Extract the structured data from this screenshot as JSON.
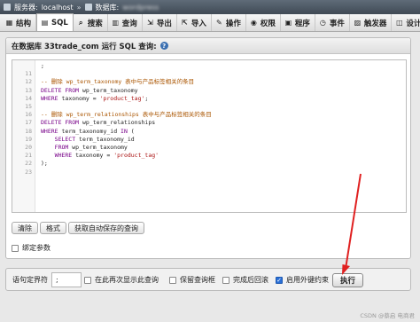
{
  "breadcrumb": {
    "server_label": "服务器:",
    "server_value": "localhost",
    "separator": "»",
    "db_label": "数据库:",
    "db_value": "wordpress"
  },
  "tabs": [
    {
      "label": "结构",
      "icon": "structure-icon",
      "glyph": "▦"
    },
    {
      "label": "SQL",
      "icon": "sql-icon",
      "glyph": "▤"
    },
    {
      "label": "搜索",
      "icon": "search-icon",
      "glyph": "⌕"
    },
    {
      "label": "查询",
      "icon": "query-icon",
      "glyph": "▥"
    },
    {
      "label": "导出",
      "icon": "export-icon",
      "glyph": "⇲"
    },
    {
      "label": "导入",
      "icon": "import-icon",
      "glyph": "⇱"
    },
    {
      "label": "操作",
      "icon": "wrench-icon",
      "glyph": "✎"
    },
    {
      "label": "权限",
      "icon": "privileges-icon",
      "glyph": "◉"
    },
    {
      "label": "程序",
      "icon": "routines-icon",
      "glyph": "▣"
    },
    {
      "label": "事件",
      "icon": "events-icon",
      "glyph": "◷"
    },
    {
      "label": "触发器",
      "icon": "triggers-icon",
      "glyph": "▨"
    },
    {
      "label": "设计器",
      "icon": "designer-icon",
      "glyph": "◫"
    }
  ],
  "panel": {
    "title": "在数据库 33trade_com 运行 SQL 查询:",
    "help_glyph": "?"
  },
  "editor": {
    "lines": [
      {
        "n": "",
        "segments": [
          {
            "t": ";",
            "c": "plain"
          }
        ]
      },
      {
        "n": "11",
        "segments": []
      },
      {
        "n": "12",
        "segments": [
          {
            "t": "-- 删除 wp_term_taxonomy 表中与产品标签相关的条目",
            "c": "cmt"
          }
        ]
      },
      {
        "n": "13",
        "segments": [
          {
            "t": "DELETE FROM",
            "c": "kw"
          },
          {
            "t": " wp_term_taxonomy",
            "c": "plain"
          }
        ]
      },
      {
        "n": "14",
        "segments": [
          {
            "t": "WHERE",
            "c": "kw"
          },
          {
            "t": " taxonomy = ",
            "c": "plain"
          },
          {
            "t": "'product_tag'",
            "c": "str"
          },
          {
            "t": ";",
            "c": "plain"
          }
        ]
      },
      {
        "n": "15",
        "segments": []
      },
      {
        "n": "16",
        "segments": [
          {
            "t": "-- 删除 wp_term_relationships 表中与产品标签相关的条目",
            "c": "cmt"
          }
        ]
      },
      {
        "n": "17",
        "segments": [
          {
            "t": "DELETE FROM",
            "c": "kw"
          },
          {
            "t": " wp_term_relationships",
            "c": "plain"
          }
        ]
      },
      {
        "n": "18",
        "segments": [
          {
            "t": "WHERE",
            "c": "kw"
          },
          {
            "t": " term_taxonomy_id ",
            "c": "plain"
          },
          {
            "t": "IN",
            "c": "kw"
          },
          {
            "t": " (",
            "c": "plain"
          }
        ]
      },
      {
        "n": "19",
        "segments": [
          {
            "t": "    ",
            "c": "plain"
          },
          {
            "t": "SELECT",
            "c": "kw"
          },
          {
            "t": " term_taxonomy_id",
            "c": "plain"
          }
        ]
      },
      {
        "n": "20",
        "segments": [
          {
            "t": "    ",
            "c": "plain"
          },
          {
            "t": "FROM",
            "c": "kw"
          },
          {
            "t": " wp_term_taxonomy",
            "c": "plain"
          }
        ]
      },
      {
        "n": "21",
        "segments": [
          {
            "t": "    ",
            "c": "plain"
          },
          {
            "t": "WHERE",
            "c": "kw"
          },
          {
            "t": " taxonomy = ",
            "c": "plain"
          },
          {
            "t": "'product_tag'",
            "c": "str"
          }
        ]
      },
      {
        "n": "22",
        "segments": [
          {
            "t": ");",
            "c": "plain"
          }
        ]
      },
      {
        "n": "23",
        "segments": []
      }
    ]
  },
  "buttons": {
    "clear": "清除",
    "format": "格式",
    "get_saved": "获取自动保存的查询"
  },
  "bind_params": "绑定参数",
  "bottom": {
    "delimiter_label": "语句定界符",
    "delimiter_value": ";",
    "show_again": "在此再次显示此查询",
    "retain_box": "保留查询框",
    "rollback": "完成后回滚",
    "fk_checks": "启用外键约束",
    "fk_checked": true,
    "go": "执行"
  },
  "watermark": "CSDN @蔡启 电商君",
  "colors": {
    "annotation_arrow": "#e02020",
    "checkbox_on": "#2a6fd6"
  }
}
